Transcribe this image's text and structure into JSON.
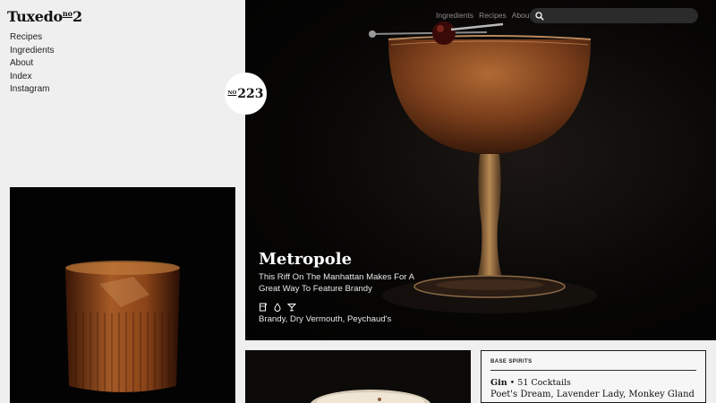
{
  "brand": {
    "logo_word": "Tuxedo",
    "logo_no": "no",
    "logo_num": "2"
  },
  "sidebar": {
    "items": [
      {
        "label": "Recipes"
      },
      {
        "label": "Ingredients"
      },
      {
        "label": "About"
      },
      {
        "label": "Index"
      },
      {
        "label": "Instagram"
      }
    ]
  },
  "badge": {
    "prefix": "NO",
    "number": "223"
  },
  "top_nav": {
    "links": [
      {
        "label": "Ingredients"
      },
      {
        "label": "Recipes"
      },
      {
        "label": "About"
      }
    ]
  },
  "search": {
    "placeholder": "",
    "icon": "search-icon"
  },
  "featured": {
    "title": "Metropole",
    "subtitle": "This Riff On The Manhattan Makes For A Great Way To Feature Brandy",
    "icons": [
      "glass-icon",
      "drop-icon",
      "cocktail-glass-icon"
    ],
    "ingredients": "Brandy, Dry Vermouth, Peychaud's"
  },
  "spirits": {
    "heading": "BASE SPIRITS",
    "spirit": "Gin",
    "separator": " • ",
    "count": "51 Cocktails",
    "examples": "Poet's Dream, Lavender Lady, Monkey Gland"
  },
  "colors": {
    "background": "#efefef",
    "hero_bg": "#050505",
    "drink": "#8a4a22"
  }
}
